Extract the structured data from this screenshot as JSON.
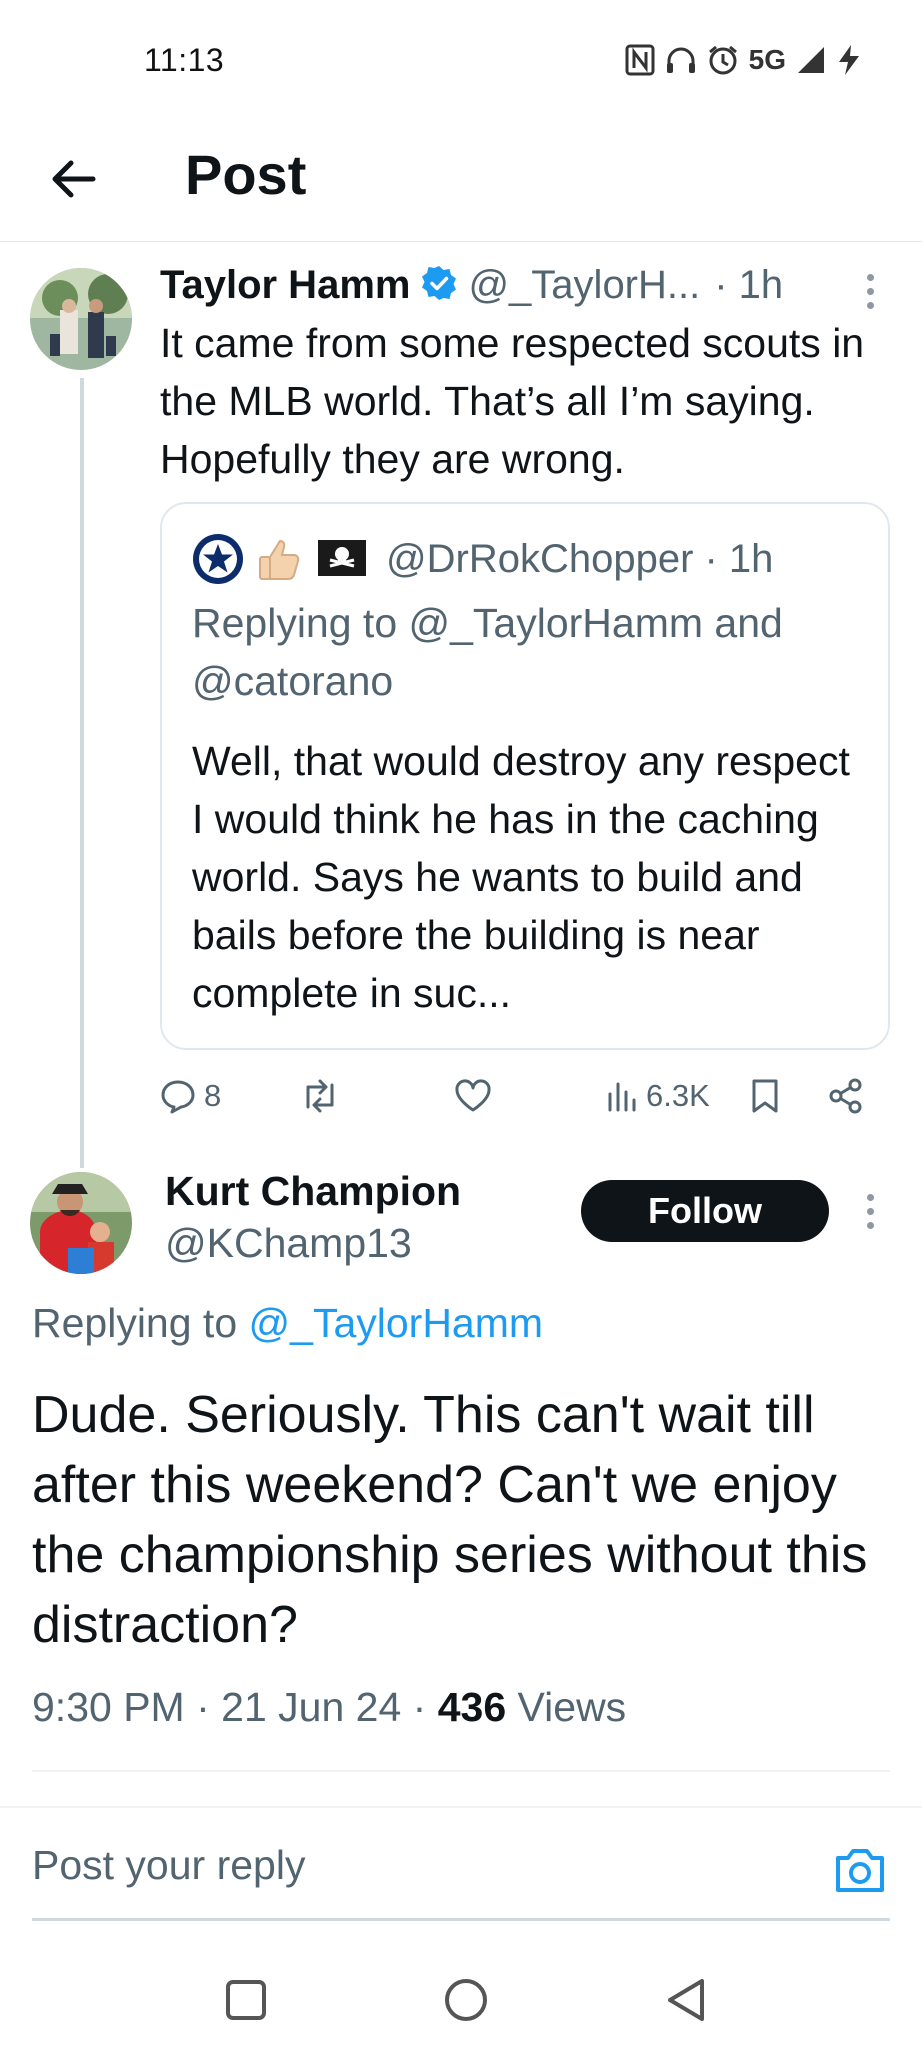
{
  "status_bar": {
    "time": "11:13",
    "network": "5G",
    "icons": [
      "nfc-icon",
      "headphones-icon",
      "alarm-icon",
      "signal-icon",
      "charging-icon"
    ]
  },
  "header": {
    "title": "Post",
    "back_icon": "arrow-left-icon"
  },
  "tweet1": {
    "name": "Taylor Hamm",
    "handle": "@_TaylorH...",
    "time": "· 1h",
    "text": "It came from some respected scouts in the MLB world. That’s all I’m saying. Hopefully they are wrong.",
    "quote": {
      "handle": "@DrRokChopper · 1h",
      "replying": "Replying to @_TaylorHamm and @catorano",
      "text": "Well, that would destroy any respect I would think he has in the caching world. Says he wants to build and bails before the building is near complete in suc..."
    },
    "actions": {
      "replies": "8",
      "views": "6.3K"
    }
  },
  "tweet2": {
    "name": "Kurt Champion",
    "handle": "@KChamp13",
    "follow_label": "Follow",
    "replying_prefix": "Replying to",
    "replying_mention": "@_TaylorHamm",
    "text": "Dude.  Seriously.  This can't wait till after this weekend?  Can't we enjoy the championship series without this distraction?",
    "time": "9:30 PM",
    "date": "21 Jun 24",
    "views_count": "436",
    "views_label": "Views"
  },
  "reply_box": {
    "placeholder": "Post your reply"
  },
  "colors": {
    "accent": "#1d9bf0",
    "text": "#0f1419",
    "secondary": "#536471"
  }
}
